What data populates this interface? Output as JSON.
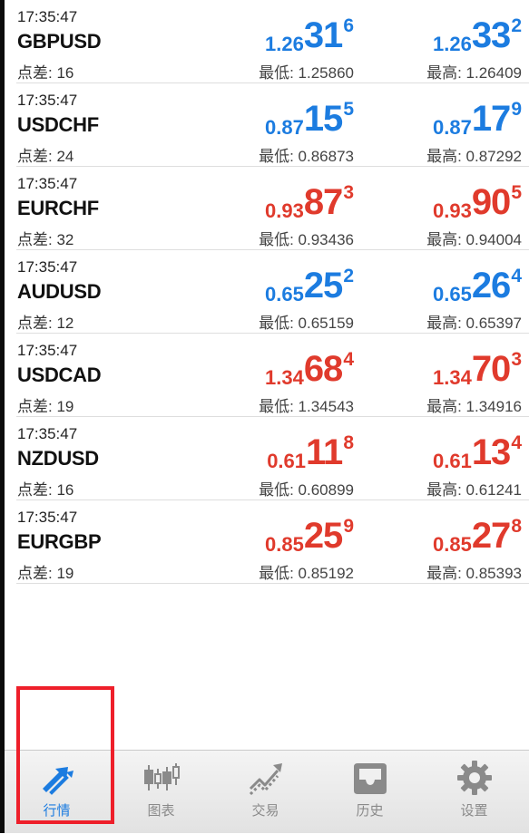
{
  "quotes": [
    {
      "time": "17:35:47",
      "symbol": "GBPUSD",
      "spread_label": "点差: 16",
      "color": "#1c7ce0",
      "bid": {
        "small": "1.26",
        "big": "31",
        "sup": "6"
      },
      "ask": {
        "small": "1.26",
        "big": "33",
        "sup": "2"
      },
      "low_label": "最低: 1.25860",
      "high_label": "最高: 1.26409"
    },
    {
      "time": "17:35:47",
      "symbol": "USDCHF",
      "spread_label": "点差: 24",
      "color": "#1c7ce0",
      "bid": {
        "small": "0.87",
        "big": "15",
        "sup": "5"
      },
      "ask": {
        "small": "0.87",
        "big": "17",
        "sup": "9"
      },
      "low_label": "最低: 0.86873",
      "high_label": "最高: 0.87292"
    },
    {
      "time": "17:35:47",
      "symbol": "EURCHF",
      "spread_label": "点差: 32",
      "color": "#e03a2c",
      "bid": {
        "small": "0.93",
        "big": "87",
        "sup": "3"
      },
      "ask": {
        "small": "0.93",
        "big": "90",
        "sup": "5"
      },
      "low_label": "最低: 0.93436",
      "high_label": "最高: 0.94004"
    },
    {
      "time": "17:35:47",
      "symbol": "AUDUSD",
      "spread_label": "点差: 12",
      "color": "#1c7ce0",
      "bid": {
        "small": "0.65",
        "big": "25",
        "sup": "2"
      },
      "ask": {
        "small": "0.65",
        "big": "26",
        "sup": "4"
      },
      "low_label": "最低: 0.65159",
      "high_label": "最高: 0.65397"
    },
    {
      "time": "17:35:47",
      "symbol": "USDCAD",
      "spread_label": "点差: 19",
      "color": "#e03a2c",
      "bid": {
        "small": "1.34",
        "big": "68",
        "sup": "4"
      },
      "ask": {
        "small": "1.34",
        "big": "70",
        "sup": "3"
      },
      "low_label": "最低: 1.34543",
      "high_label": "最高: 1.34916"
    },
    {
      "time": "17:35:47",
      "symbol": "NZDUSD",
      "spread_label": "点差: 16",
      "color": "#e03a2c",
      "bid": {
        "small": "0.61",
        "big": "11",
        "sup": "8"
      },
      "ask": {
        "small": "0.61",
        "big": "13",
        "sup": "4"
      },
      "low_label": "最低: 0.60899",
      "high_label": "最高: 0.61241"
    },
    {
      "time": "17:35:47",
      "symbol": "EURGBP",
      "spread_label": "点差: 19",
      "color": "#e03a2c",
      "bid": {
        "small": "0.85",
        "big": "25",
        "sup": "9"
      },
      "ask": {
        "small": "0.85",
        "big": "27",
        "sup": "8"
      },
      "low_label": "最低: 0.85192",
      "high_label": "最高: 0.85393"
    }
  ],
  "tabbar": {
    "tabs": [
      {
        "label": "行情",
        "icon": "quotes-arrows-icon",
        "active": true
      },
      {
        "label": "图表",
        "icon": "candlestick-chart-icon",
        "active": false
      },
      {
        "label": "交易",
        "icon": "trade-trend-icon",
        "active": false
      },
      {
        "label": "历史",
        "icon": "history-inbox-icon",
        "active": false
      },
      {
        "label": "设置",
        "icon": "settings-gear-icon",
        "active": false
      }
    ]
  },
  "colors": {
    "up": "#1c7ce0",
    "down": "#e03a2c",
    "active_tab": "#1c7ce0",
    "inactive_tab": "#8a8a8a",
    "highlight": "#ee1f2a"
  }
}
